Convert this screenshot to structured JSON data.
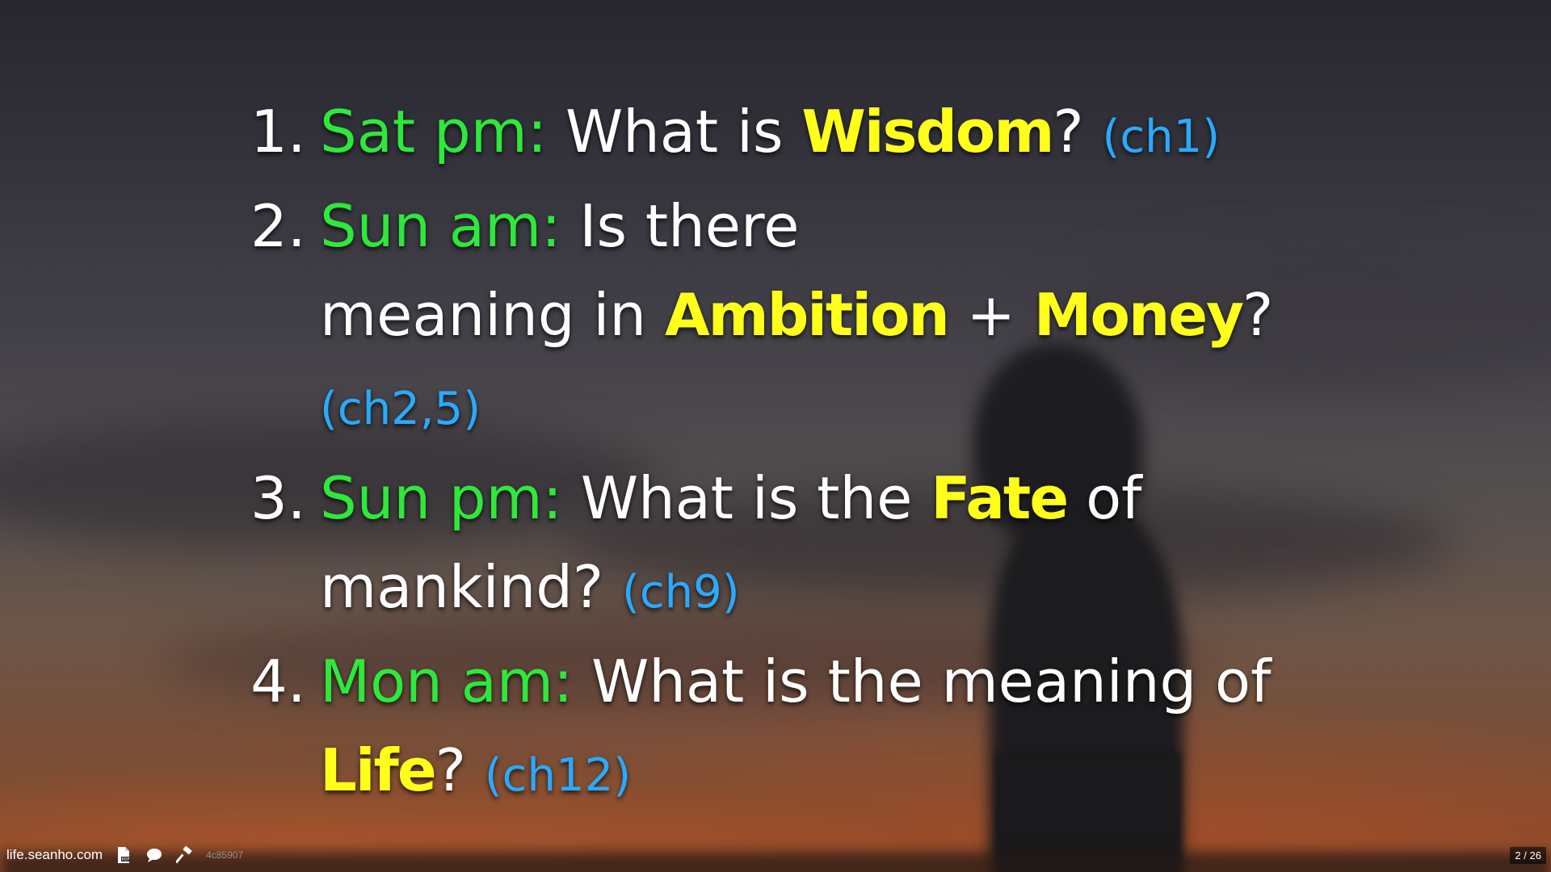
{
  "agenda": [
    {
      "number": "1.",
      "when": "Sat pm:",
      "lead": "What is",
      "keyword": "Wisdom",
      "tail": "?",
      "chapter": "(ch1)"
    },
    {
      "number": "2.",
      "when": "Sun am:",
      "lead": "Is there",
      "lead2": "meaning in",
      "keyword": "Ambition",
      "joiner": "+",
      "keyword2": "Money",
      "tail": "?",
      "chapter": "(ch2,5)"
    },
    {
      "number": "3.",
      "when": "Sun pm:",
      "lead": "What is the",
      "keyword": "Fate",
      "tail": "of",
      "tail2": "mankind?",
      "chapter": "(ch9)"
    },
    {
      "number": "4.",
      "when": "Mon am:",
      "lead": "What is the meaning of",
      "keyword": "Life",
      "tail": "?",
      "chapter": "(ch12)"
    }
  ],
  "footer": {
    "site": "life.seanho.com",
    "icons": [
      "pdf-icon",
      "comment-icon",
      "hammer-icon"
    ],
    "commit_hash": "4c85907"
  },
  "pager": {
    "current": "2",
    "separator": "/",
    "total": "26"
  },
  "colors": {
    "time_label": "#2ee83c",
    "keyword": "#ffff1a",
    "chapter_ref": "#2aaaff",
    "body_text": "#ffffff"
  }
}
